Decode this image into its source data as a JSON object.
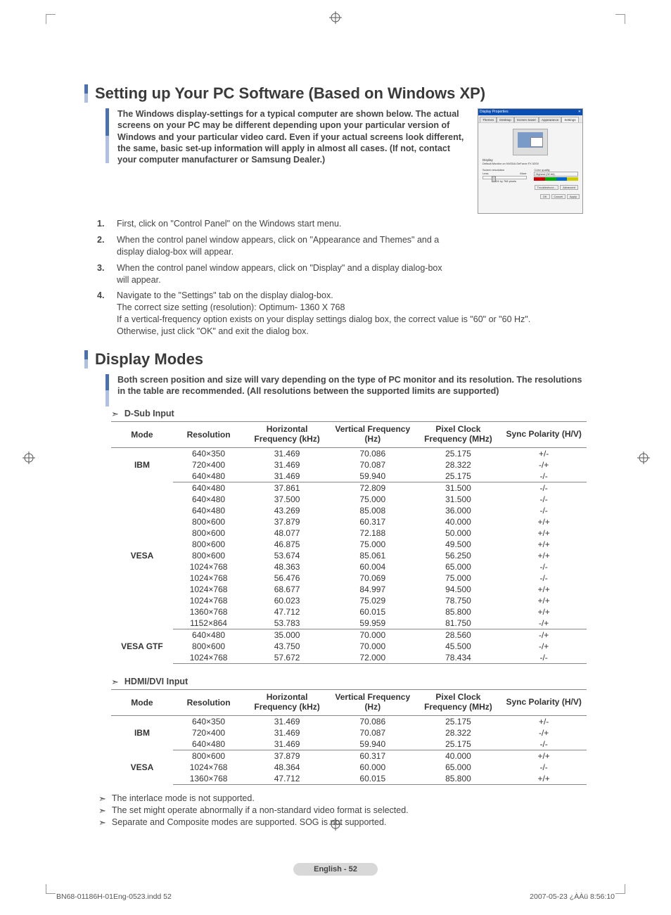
{
  "section1": {
    "title": "Setting up Your PC Software (Based on Windows XP)",
    "intro": "The Windows display-settings for a typical computer are shown below. The actual screens on your PC may be different depending upon your particular version of Windows and your particular video card. Even if your actual screens look different, the same, basic set-up information will apply in almost all cases. (If not, contact your computer manufacturer or Samsung Dealer.)",
    "steps": [
      "First, click on \"Control Panel\" on the Windows start menu.",
      "When the control panel window appears, click on \"Appearance and Themes\" and a display dialog-box will appear.",
      "When the control panel window appears, click on \"Display\" and a display dialog-box will appear.",
      "Navigate to the \"Settings\" tab on the display dialog-box.\nThe correct size setting (resolution): Optimum- 1360 X 768\nIf a vertical-frequency option exists on your display settings dialog box, the correct value is \"60\" or \"60 Hz\". Otherwise, just click \"OK\" and exit the dialog box."
    ]
  },
  "dialog": {
    "title": "Display Properties",
    "tabs": [
      "Themes",
      "Desktop",
      "Screen Saver",
      "Appearance",
      "Settings"
    ],
    "display_label": "Display",
    "display_value": "Default Monitor on NVIDIA GeForce FX 5200",
    "screen_res_label": "Screen resolution",
    "less": "Less",
    "more": "More",
    "color_quality_label": "Color quality",
    "color_quality_value": "Highest (32 bit)",
    "res_value": "1024 by 768 pixels",
    "troubleshoot": "Troubleshoot...",
    "advanced": "Advanced",
    "ok": "OK",
    "cancel": "Cancel",
    "apply": "Apply"
  },
  "section2": {
    "title": "Display Modes",
    "intro": "Both screen position and size will vary depending on the type of PC monitor and its resolution. The resolutions in the table are recommended. (All resolutions between the supported limits are supported)",
    "dsub_label": "D-Sub Input",
    "hdmi_label": "HDMI/DVI Input",
    "headers": {
      "mode": "Mode",
      "resolution": "Resolution",
      "hfreq": "Horizontal Frequency (kHz)",
      "vfreq": "Vertical Frequency (Hz)",
      "pclk": "Pixel Clock Frequency (MHz)",
      "sync": "Sync Polarity (H/V)"
    },
    "dsub_groups": [
      {
        "mode": "IBM",
        "rows": [
          [
            "640×350",
            "31.469",
            "70.086",
            "25.175",
            "+/-"
          ],
          [
            "720×400",
            "31.469",
            "70.087",
            "28.322",
            "-/+"
          ],
          [
            "640×480",
            "31.469",
            "59.940",
            "25.175",
            "-/-"
          ]
        ]
      },
      {
        "mode": "VESA",
        "rows": [
          [
            "640×480",
            "37.861",
            "72.809",
            "31.500",
            "-/-"
          ],
          [
            "640×480",
            "37.500",
            "75.000",
            "31.500",
            "-/-"
          ],
          [
            "640×480",
            "43.269",
            "85.008",
            "36.000",
            "-/-"
          ],
          [
            "800×600",
            "37.879",
            "60.317",
            "40.000",
            "+/+"
          ],
          [
            "800×600",
            "48.077",
            "72.188",
            "50.000",
            "+/+"
          ],
          [
            "800×600",
            "46.875",
            "75.000",
            "49.500",
            "+/+"
          ],
          [
            "800×600",
            "53.674",
            "85.061",
            "56.250",
            "+/+"
          ],
          [
            "1024×768",
            "48.363",
            "60.004",
            "65.000",
            "-/-"
          ],
          [
            "1024×768",
            "56.476",
            "70.069",
            "75.000",
            "-/-"
          ],
          [
            "1024×768",
            "68.677",
            "84.997",
            "94.500",
            "+/+"
          ],
          [
            "1024×768",
            "60.023",
            "75.029",
            "78.750",
            "+/+"
          ],
          [
            "1360×768",
            "47.712",
            "60.015",
            "85.800",
            "+/+"
          ],
          [
            "1152×864",
            "53.783",
            "59.959",
            "81.750",
            "-/+"
          ]
        ]
      },
      {
        "mode": "VESA GTF",
        "rows": [
          [
            "640×480",
            "35.000",
            "70.000",
            "28.560",
            "-/+"
          ],
          [
            "800×600",
            "43.750",
            "70.000",
            "45.500",
            "-/+"
          ],
          [
            "1024×768",
            "57.672",
            "72.000",
            "78.434",
            "-/-"
          ]
        ]
      }
    ],
    "hdmi_groups": [
      {
        "mode": "IBM",
        "rows": [
          [
            "640×350",
            "31.469",
            "70.086",
            "25.175",
            "+/-"
          ],
          [
            "720×400",
            "31.469",
            "70.087",
            "28.322",
            "-/+"
          ],
          [
            "640×480",
            "31.469",
            "59.940",
            "25.175",
            "-/-"
          ]
        ]
      },
      {
        "mode": "VESA",
        "rows": [
          [
            "800×600",
            "37.879",
            "60.317",
            "40.000",
            "+/+"
          ],
          [
            "1024×768",
            "48.364",
            "60.000",
            "65.000",
            "-/-"
          ],
          [
            "1360×768",
            "47.712",
            "60.015",
            "85.800",
            "+/+"
          ]
        ]
      }
    ],
    "notes": [
      "The interlace mode is not supported.",
      "The set might operate abnormally if a non-standard video format is selected.",
      "Separate and Composite modes are supported. SOG is not supported."
    ]
  },
  "page_badge": "English - 52",
  "footer": {
    "left": "BN68-01186H-01Eng-0523.indd   52",
    "right": "2007-05-23   ¿ÀÀü 8:56:10"
  }
}
